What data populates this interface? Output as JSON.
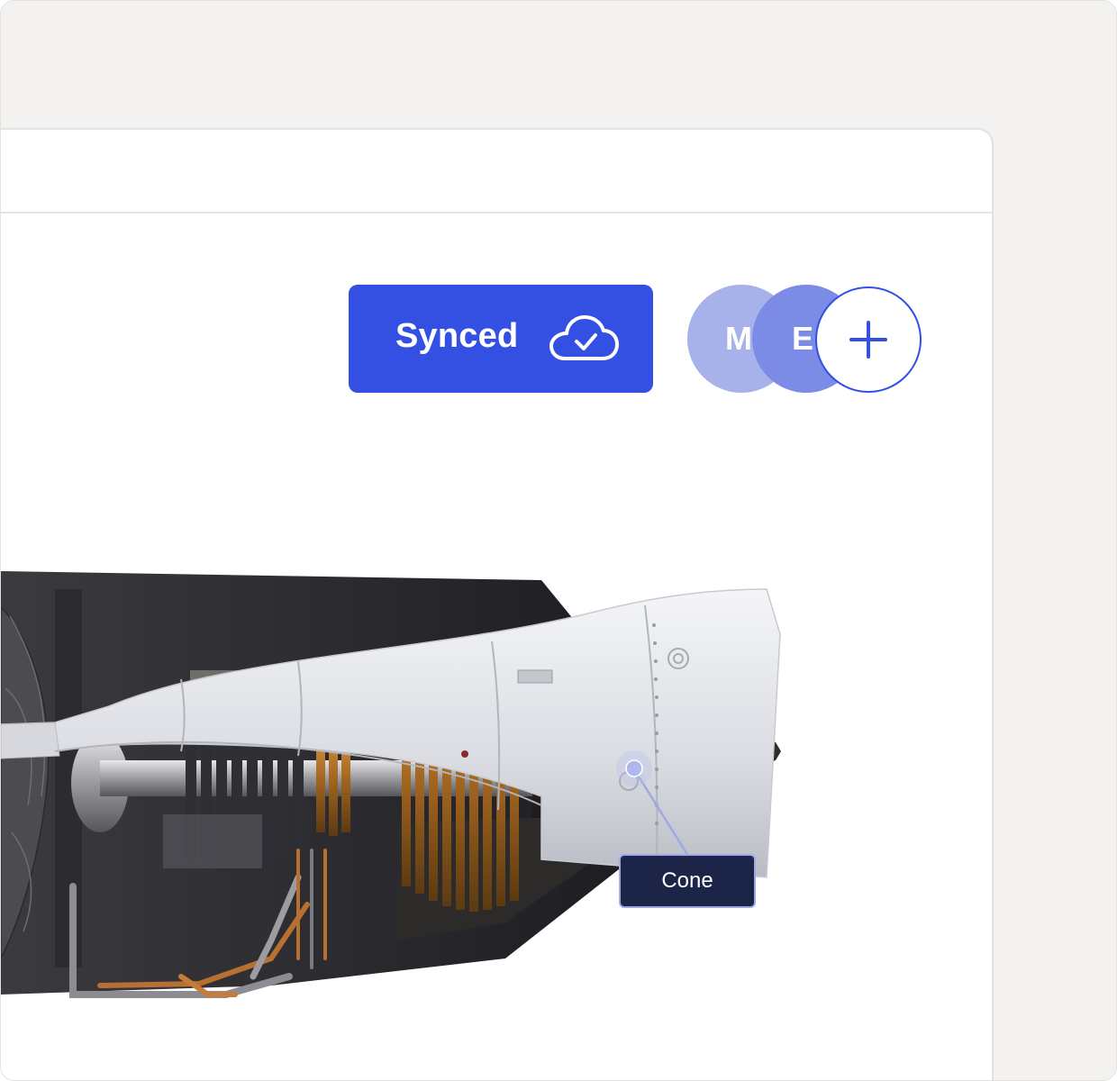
{
  "status": {
    "label": "Synced",
    "icon": "cloud-check-icon",
    "color": "#3350e2"
  },
  "collaborators": [
    {
      "initial": "M",
      "color": "#a8b2ea"
    },
    {
      "initial": "E",
      "color": "#7b8be6"
    }
  ],
  "add_collaborator": {
    "icon": "plus-icon"
  },
  "model": {
    "subject": "jet-engine-cutaway",
    "annotation": {
      "label": "Cone"
    }
  }
}
